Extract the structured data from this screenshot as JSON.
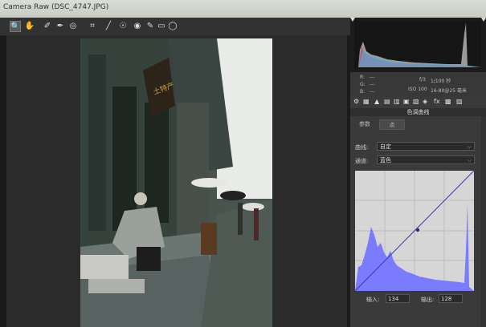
{
  "window": {
    "title": "Camera Raw (DSC_4747.JPG)"
  },
  "toolbar": {
    "tools": [
      "zoom-tool",
      "hand-tool",
      "white-balance-tool",
      "color-sampler-tool",
      "targeted-adjustment-tool",
      "crop-tool",
      "straighten-tool",
      "spot-removal-tool",
      "red-eye-tool",
      "adjustment-brush-tool",
      "graduated-filter-tool",
      "radial-filter-tool"
    ]
  },
  "photo": {
    "sign_text": "土特产",
    "description_colors": {
      "sky": "#e9ebe8",
      "wall": "#3c4a42",
      "steps": "#5c6561"
    }
  },
  "histogram": {
    "colors": [
      "#ff3b3b",
      "#4ac3ff",
      "#e4e4e4"
    ]
  },
  "exif": {
    "r_label": "R:",
    "g_label": "G:",
    "b_label": "B:",
    "r_val": "---",
    "g_val": "---",
    "b_val": "---",
    "aperture": "f/3",
    "shutter": "1/100 秒",
    "iso": "ISO 100",
    "lens": "16-80@25 毫米"
  },
  "panel": {
    "section_title": "色调曲线",
    "tabs": [
      "参数",
      "点"
    ],
    "curve_label": "曲线:",
    "curve_value": "自定",
    "channel_label": "通道:",
    "channel_value": "蓝色",
    "input_label": "输入:",
    "input_value": "134",
    "output_label": "输出:",
    "output_value": "128"
  },
  "colors": {
    "curve_bg": "#d6d6d6",
    "histogram_blue": "#7b7bff",
    "curve_line": "#3a3aa8"
  }
}
